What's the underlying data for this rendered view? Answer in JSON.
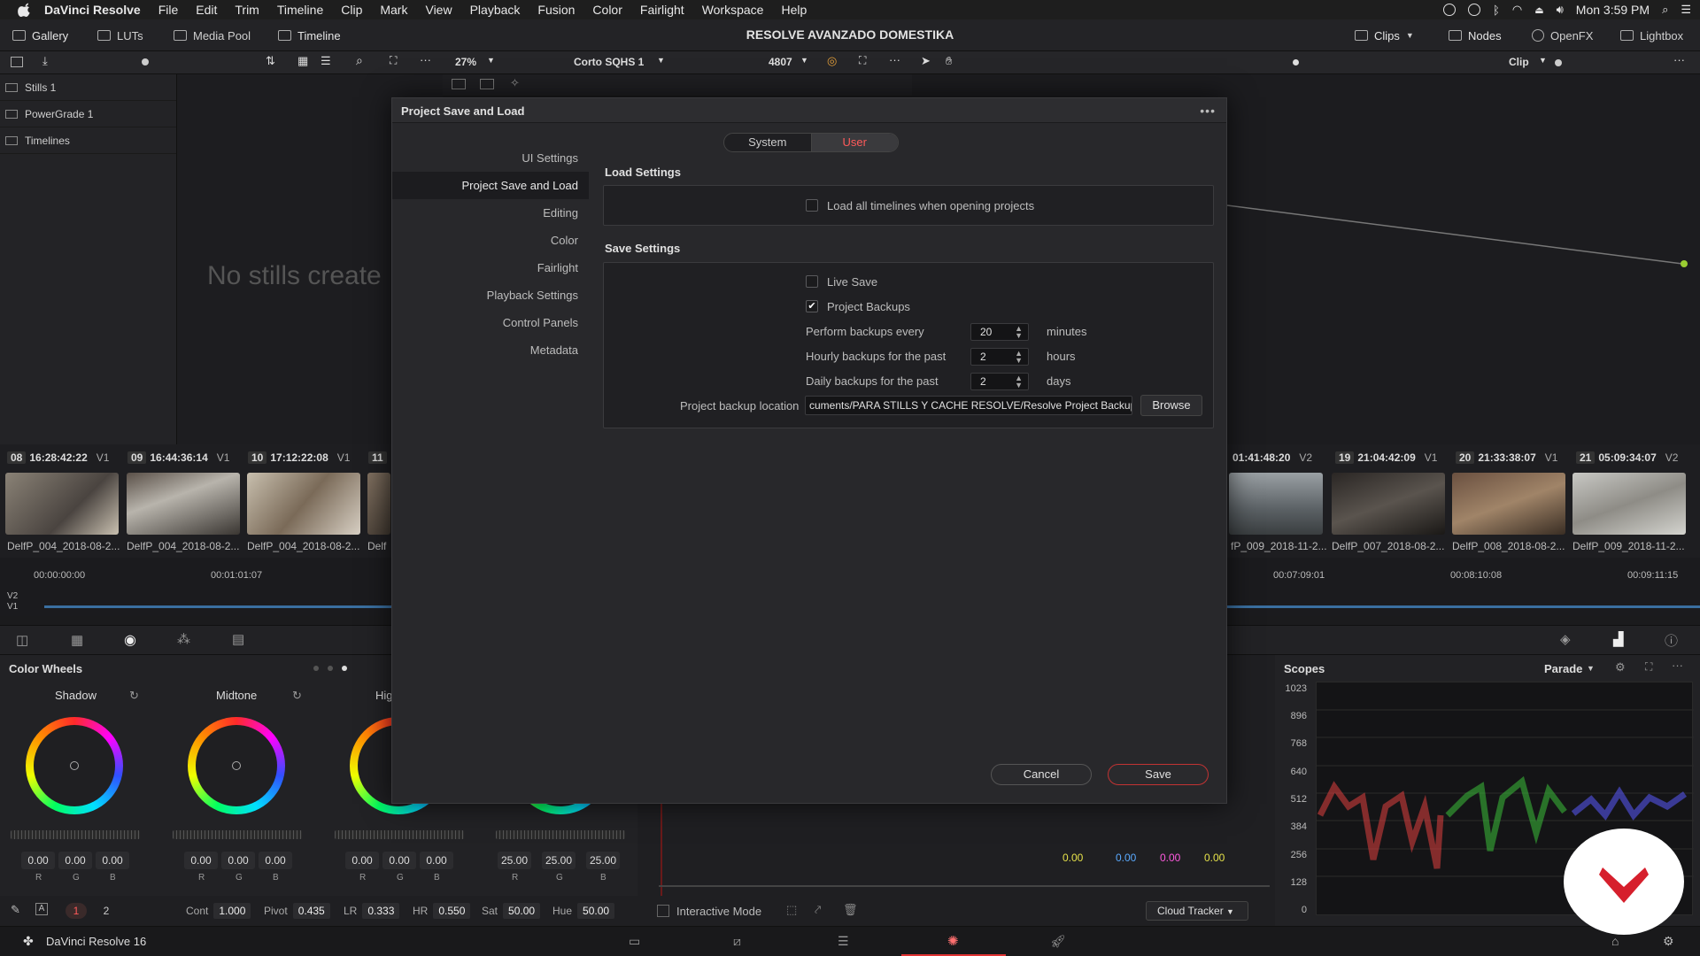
{
  "menubar": {
    "app": "DaVinci Resolve",
    "items": [
      "File",
      "Edit",
      "Trim",
      "Timeline",
      "Clip",
      "Mark",
      "View",
      "Playback",
      "Fusion",
      "Color",
      "Fairlight",
      "Workspace",
      "Help"
    ],
    "clock": "Mon 3:59 PM"
  },
  "toolbar": {
    "gallery": "Gallery",
    "luts": "LUTs",
    "media_pool": "Media Pool",
    "timeline": "Timeline",
    "project_title": "RESOLVE AVANZADO DOMESTIKA",
    "clips": "Clips",
    "nodes": "Nodes",
    "openfx": "OpenFX",
    "lightbox": "Lightbox"
  },
  "toolbar2": {
    "zoom": "27%",
    "timeline_name": "Corto SQHS 1",
    "frame": "4807",
    "mode": "Clip"
  },
  "gallery_panel": {
    "items": [
      "Stills 1",
      "PowerGrade 1",
      "Timelines"
    ],
    "empty_text": "No stills create"
  },
  "clips": [
    {
      "num": "08",
      "tc": "16:28:42:22",
      "track": "V1",
      "name": "DelfP_004_2018-08-2..."
    },
    {
      "num": "09",
      "tc": "16:44:36:14",
      "track": "V1",
      "name": "DelfP_004_2018-08-2..."
    },
    {
      "num": "10",
      "tc": "17:12:22:08",
      "track": "V1",
      "name": "DelfP_004_2018-08-2..."
    },
    {
      "num": "11",
      "tc": "",
      "track": "",
      "name": "Delf"
    },
    {
      "num": "",
      "tc": "01:41:48:20",
      "track": "V2",
      "name": "fP_009_2018-11-2..."
    },
    {
      "num": "19",
      "tc": "21:04:42:09",
      "track": "V1",
      "name": "DelfP_007_2018-08-2..."
    },
    {
      "num": "20",
      "tc": "21:33:38:07",
      "track": "V1",
      "name": "DelfP_008_2018-08-2..."
    },
    {
      "num": "21",
      "tc": "05:09:34:07",
      "track": "V2",
      "name": "DelfP_009_2018-11-2..."
    }
  ],
  "timeline": {
    "ticks": [
      "00:00:00:00",
      "00:01:01:07",
      "00:07:09:01",
      "00:08:10:08",
      "00:09:11:15"
    ],
    "tracks": [
      "V2",
      "V1"
    ]
  },
  "color_wheels": {
    "title": "Color Wheels",
    "wheels": [
      {
        "label": "Shadow",
        "values": [
          "0.00",
          "0.00",
          "0.00"
        ]
      },
      {
        "label": "Midtone",
        "values": [
          "0.00",
          "0.00",
          "0.00"
        ]
      },
      {
        "label": "Hig",
        "values": [
          "0.00",
          "0.00",
          "0.00"
        ]
      },
      {
        "label": "",
        "values": [
          "25.00",
          "25.00",
          "25.00"
        ]
      }
    ],
    "channels": [
      "R",
      "G",
      "B"
    ]
  },
  "params": {
    "page1": "1",
    "page2": "2",
    "cont_label": "Cont",
    "cont": "1.000",
    "pivot_label": "Pivot",
    "pivot": "0.435",
    "lr_label": "LR",
    "lr": "0.333",
    "hr_label": "HR",
    "hr": "0.550",
    "sat_label": "Sat",
    "sat": "50.00",
    "hue_label": "Hue",
    "hue": "50.00"
  },
  "mid_panel": {
    "values": [
      "0.00",
      "0.00",
      "0.00",
      "0.00"
    ],
    "interactive_mode": "Interactive Mode",
    "tracker": "Cloud Tracker"
  },
  "scopes": {
    "title": "Scopes",
    "mode": "Parade",
    "y_ticks": [
      "1023",
      "896",
      "768",
      "640",
      "512",
      "384",
      "256",
      "128",
      "0"
    ]
  },
  "status": {
    "app_version": "DaVinci Resolve 16"
  },
  "dialog": {
    "title": "Project Save and Load",
    "tabs": {
      "system": "System",
      "user": "User"
    },
    "nav": [
      "UI Settings",
      "Project Save and Load",
      "Editing",
      "Color",
      "Fairlight",
      "Playback Settings",
      "Control Panels",
      "Metadata"
    ],
    "load_settings": "Load Settings",
    "load_all_timelines": "Load all timelines when opening projects",
    "save_settings": "Save Settings",
    "live_save": "Live Save",
    "project_backups": "Project Backups",
    "perform_backups_every": "Perform backups every",
    "perform_value": "20",
    "minutes": "minutes",
    "hourly_backups": "Hourly backups for the past",
    "hourly_value": "2",
    "hours": "hours",
    "daily_backups": "Daily backups for the past",
    "daily_value": "2",
    "days": "days",
    "backup_location_label": "Project backup location",
    "backup_location": "cuments/PARA STILLS Y CACHE RESOLVE/Resolve Project Backups",
    "browse": "Browse",
    "cancel": "Cancel",
    "save": "Save"
  }
}
